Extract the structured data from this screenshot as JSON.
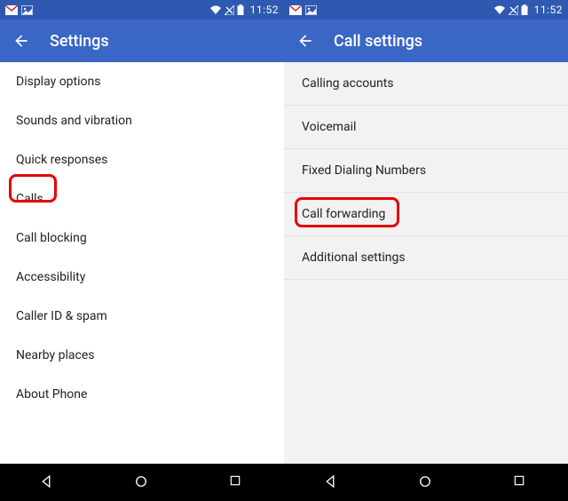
{
  "status_time": "11:52",
  "screens": [
    {
      "title": "Settings",
      "background": "left",
      "bordered": false,
      "items": [
        {
          "label": "Display options",
          "highlighted": false
        },
        {
          "label": "Sounds and vibration",
          "highlighted": false
        },
        {
          "label": "Quick responses",
          "highlighted": false
        },
        {
          "label": "Calls",
          "highlighted": true
        },
        {
          "label": "Call blocking",
          "highlighted": false
        },
        {
          "label": "Accessibility",
          "highlighted": false
        },
        {
          "label": "Caller ID & spam",
          "highlighted": false
        },
        {
          "label": "Nearby places",
          "highlighted": false
        },
        {
          "label": "About Phone",
          "highlighted": false
        }
      ]
    },
    {
      "title": "Call settings",
      "background": "right",
      "bordered": true,
      "items": [
        {
          "label": "Calling accounts",
          "highlighted": false
        },
        {
          "label": "Voicemail",
          "highlighted": false
        },
        {
          "label": "Fixed Dialing Numbers",
          "highlighted": false
        },
        {
          "label": "Call forwarding",
          "highlighted": true
        },
        {
          "label": "Additional settings",
          "highlighted": false
        }
      ]
    }
  ],
  "colors": {
    "statusbar": "#2f59b1",
    "appbar": "#3a66c6",
    "highlight": "#e60000"
  }
}
